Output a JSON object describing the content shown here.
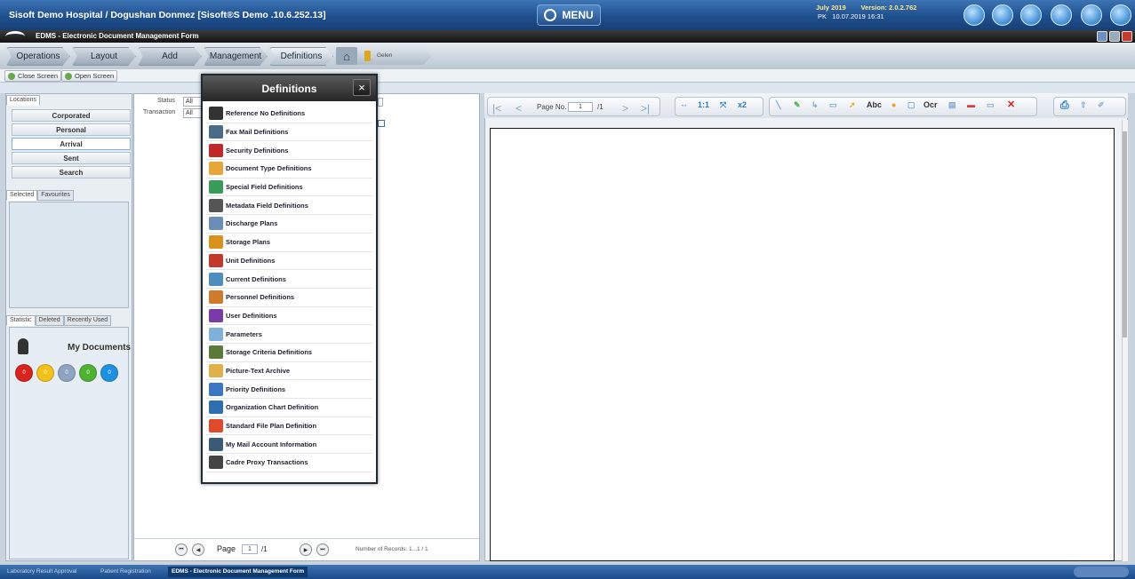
{
  "titlebar": {
    "app_title": "Sisoft Demo Hospital / Dogushan Donmez [Sisoft®S Demo .10.6.252.13]",
    "menu_label": "MENU",
    "date_label": "July 2019",
    "version_label": "Version: 2.0.2.762",
    "status_code": "PK",
    "datetime": "10.07.2019  16:31"
  },
  "formbar": {
    "title": "EDMS - Electronic Document Management Form"
  },
  "menustrip": {
    "tabs": [
      "Operations",
      "Layout",
      "Add",
      "Management",
      "Definitions"
    ],
    "breadcrumb": "Gelen"
  },
  "screenbar": {
    "close_label": "Close Screen",
    "open_label": "Open Screen"
  },
  "leftpanel": {
    "locations_tab": "Locations",
    "locations": [
      "Corporated",
      "Personal",
      "Arrival",
      "Sent",
      "Search"
    ],
    "tabs2": [
      "Selected",
      "Favourites"
    ],
    "tabs3": [
      "Statistic",
      "Deleted",
      "Recently Used"
    ],
    "my_documents": "My Documents",
    "dots": [
      {
        "value": "0",
        "color": "#d8241c"
      },
      {
        "value": "0",
        "color": "#f2c21b"
      },
      {
        "value": "0",
        "color": "#8fa3c2"
      },
      {
        "value": "0",
        "color": "#4fb233"
      },
      {
        "value": "0",
        "color": "#1e90e0"
      }
    ]
  },
  "midpanel": {
    "status_label": "Status",
    "status_value": "All",
    "transaction_label": "Transaction",
    "transaction_value": "All",
    "page_label": "Page",
    "page_value": "1",
    "page_total": "/1",
    "records": "Number of Records: 1...1 / 1"
  },
  "viewer": {
    "page_no_label": "Page No.",
    "page_value": "1",
    "page_total": "/1",
    "tool_labels": [
      "1:1",
      "x2",
      "Abc",
      "Ocr"
    ]
  },
  "modal": {
    "title": "Definitions",
    "close": "×",
    "items": [
      {
        "label": "Reference No Definitions",
        "icon": "list-icon",
        "color": "#333"
      },
      {
        "label": "Fax Mail Definitions",
        "icon": "fax-icon",
        "color": "#4a6b8a"
      },
      {
        "label": "Security Definitions",
        "icon": "shield-icon",
        "color": "#c0282a"
      },
      {
        "label": "Document Type Definitions",
        "icon": "folder-icon",
        "color": "#e8a53a"
      },
      {
        "label": "Special Field Definitions",
        "icon": "field-icon",
        "color": "#3a9c5a"
      },
      {
        "label": "Metadata Field Definitions",
        "icon": "metadata-icon",
        "color": "#555"
      },
      {
        "label": "Discharge Plans",
        "icon": "discharge-icon",
        "color": "#6b8eb8"
      },
      {
        "label": "Storage Plans",
        "icon": "storage-icon",
        "color": "#d9921c"
      },
      {
        "label": "Unit Definitions",
        "icon": "org-unit-icon",
        "color": "#c0392b"
      },
      {
        "label": "Current Definitions",
        "icon": "current-icon",
        "color": "#4c8fbf"
      },
      {
        "label": "Personnel Definitions",
        "icon": "personnel-icon",
        "color": "#d07a2b"
      },
      {
        "label": "User Definitions",
        "icon": "users-icon",
        "color": "#7a3aa8"
      },
      {
        "label": "Parameters",
        "icon": "parameters-icon",
        "color": "#7fb0d8"
      },
      {
        "label": "Storage Criteria Definitions",
        "icon": "criteria-icon",
        "color": "#5a7a3a"
      },
      {
        "label": "Picture-Text Archive",
        "icon": "archive-icon",
        "color": "#e0b04a"
      },
      {
        "label": "Priority Definitions",
        "icon": "priority-icon",
        "color": "#3b78c4"
      },
      {
        "label": "Organization Chart Definition",
        "icon": "org-chart-icon",
        "color": "#2f6fb0"
      },
      {
        "label": "Standard File Plan Definition",
        "icon": "file-plan-icon",
        "color": "#e04a2a"
      },
      {
        "label": "My Mail Account Information",
        "icon": "mail-account-icon",
        "color": "#3b5a78"
      },
      {
        "label": "Cadre Proxy Transactions",
        "icon": "proxy-icon",
        "color": "#444"
      }
    ]
  },
  "taskbar": {
    "tasks": [
      "Laboratory Result Approval",
      "Patient Registration",
      "EDMS - Electronic Document Management Form"
    ]
  }
}
